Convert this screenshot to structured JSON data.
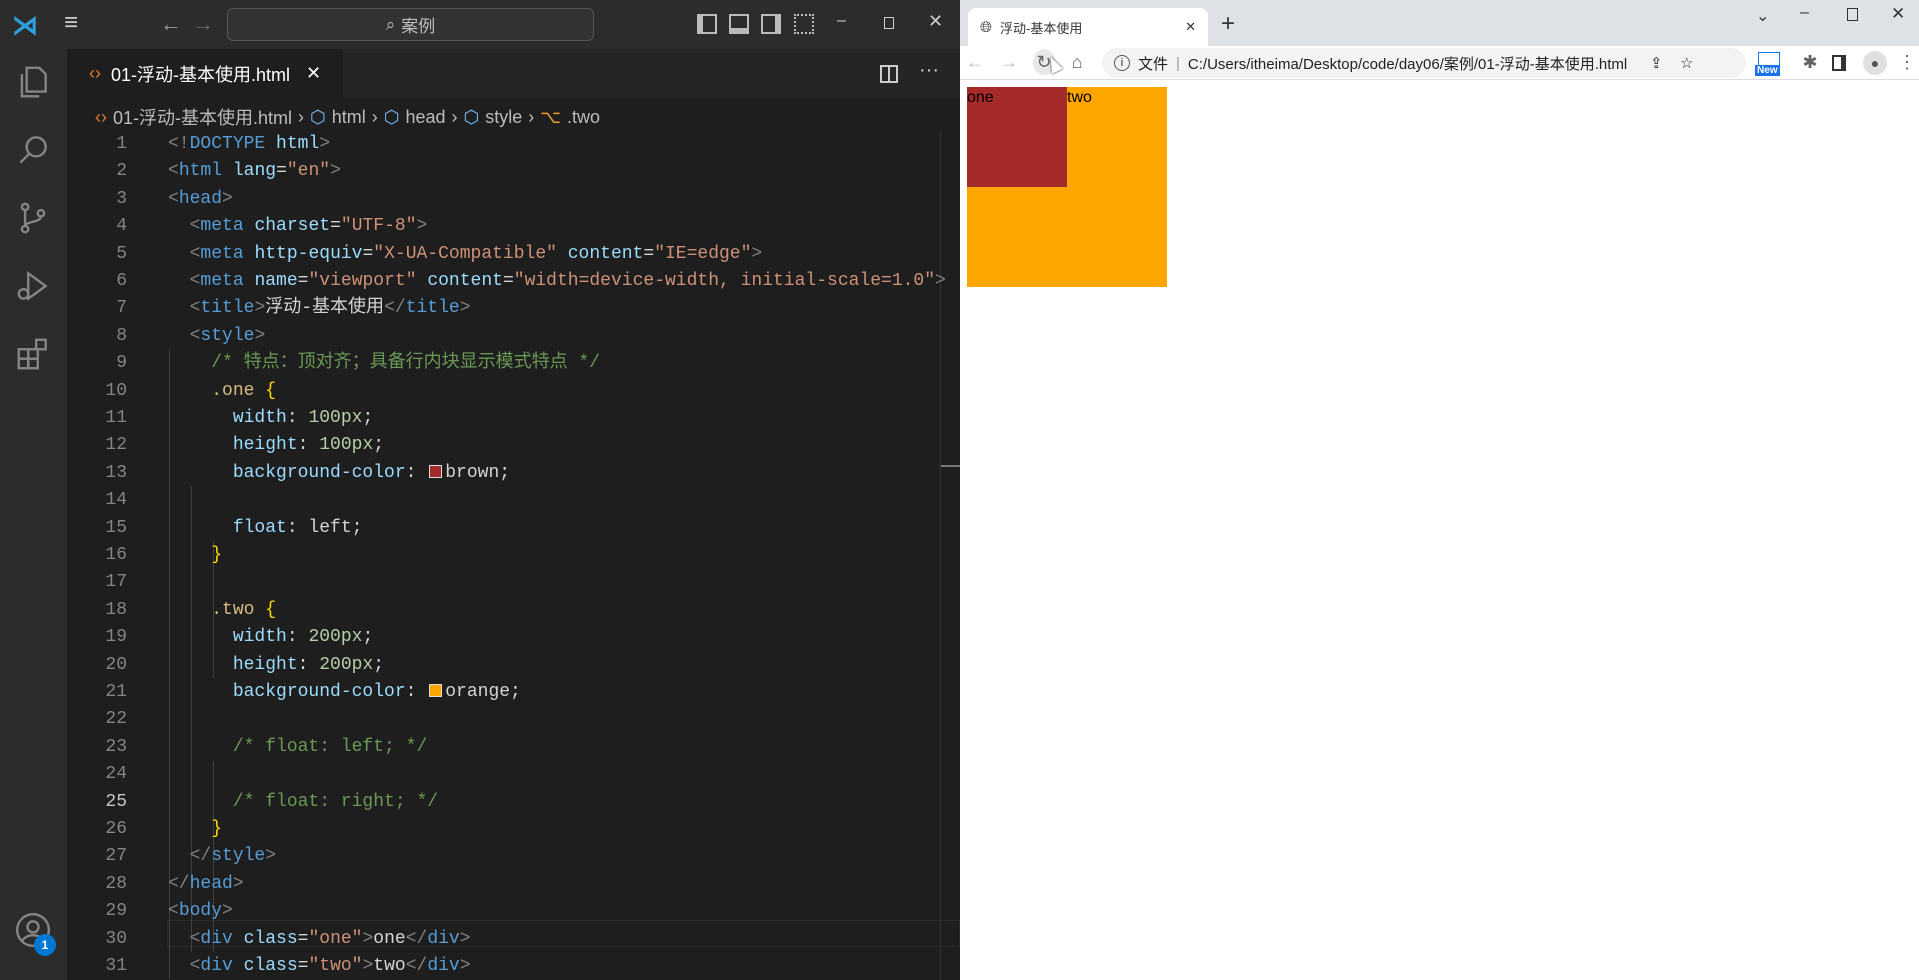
{
  "vscode": {
    "search_text": "案例",
    "tab_label": "01-浮动-基本使用.html",
    "breadcrumb": [
      "01-浮动-基本使用.html",
      "html",
      "head",
      "style",
      ".two"
    ],
    "account_badge": "1",
    "current_line": 25,
    "code": [
      [
        [
          "p",
          "<!"
        ],
        [
          "t",
          "DOCTYPE"
        ],
        [
          "w",
          " "
        ],
        [
          "a",
          "html"
        ],
        [
          "p",
          ">"
        ]
      ],
      [
        [
          "p",
          "<"
        ],
        [
          "t",
          "html"
        ],
        [
          "w",
          " "
        ],
        [
          "a",
          "lang"
        ],
        [
          "w",
          "="
        ],
        [
          "s",
          "\"en\""
        ],
        [
          "p",
          ">"
        ]
      ],
      [
        [
          "p",
          "<"
        ],
        [
          "t",
          "head"
        ],
        [
          "p",
          ">"
        ]
      ],
      [
        [
          "w",
          "  "
        ],
        [
          "p",
          "<"
        ],
        [
          "t",
          "meta"
        ],
        [
          "w",
          " "
        ],
        [
          "a",
          "charset"
        ],
        [
          "w",
          "="
        ],
        [
          "s",
          "\"UTF-8\""
        ],
        [
          "p",
          ">"
        ]
      ],
      [
        [
          "w",
          "  "
        ],
        [
          "p",
          "<"
        ],
        [
          "t",
          "meta"
        ],
        [
          "w",
          " "
        ],
        [
          "a",
          "http-equiv"
        ],
        [
          "w",
          "="
        ],
        [
          "s",
          "\"X-UA-Compatible\""
        ],
        [
          "w",
          " "
        ],
        [
          "a",
          "content"
        ],
        [
          "w",
          "="
        ],
        [
          "s",
          "\"IE=edge\""
        ],
        [
          "p",
          ">"
        ]
      ],
      [
        [
          "w",
          "  "
        ],
        [
          "p",
          "<"
        ],
        [
          "t",
          "meta"
        ],
        [
          "w",
          " "
        ],
        [
          "a",
          "name"
        ],
        [
          "w",
          "="
        ],
        [
          "s",
          "\"viewport\""
        ],
        [
          "w",
          " "
        ],
        [
          "a",
          "content"
        ],
        [
          "w",
          "="
        ],
        [
          "s",
          "\"width=device-width, initial-scale=1.0\""
        ],
        [
          "p",
          ">"
        ]
      ],
      [
        [
          "w",
          "  "
        ],
        [
          "p",
          "<"
        ],
        [
          "t",
          "title"
        ],
        [
          "p",
          ">"
        ],
        [
          "w",
          "浮动-基本使用"
        ],
        [
          "p",
          "</"
        ],
        [
          "t",
          "title"
        ],
        [
          "p",
          ">"
        ]
      ],
      [
        [
          "w",
          "  "
        ],
        [
          "p",
          "<"
        ],
        [
          "t",
          "style"
        ],
        [
          "p",
          ">"
        ]
      ],
      [
        [
          "w",
          "    "
        ],
        [
          "c",
          "/* 特点：顶对齐；具备行内块显示模式特点 */"
        ]
      ],
      [
        [
          "w",
          "    "
        ],
        [
          "sel",
          ".one"
        ],
        [
          "w",
          " "
        ],
        [
          "b",
          "{"
        ]
      ],
      [
        [
          "w",
          "      "
        ],
        [
          "a",
          "width"
        ],
        [
          "w",
          ": "
        ],
        [
          "n",
          "100px"
        ],
        [
          "w",
          ";"
        ]
      ],
      [
        [
          "w",
          "      "
        ],
        [
          "a",
          "height"
        ],
        [
          "w",
          ": "
        ],
        [
          "n",
          "100px"
        ],
        [
          "w",
          ";"
        ]
      ],
      [
        [
          "w",
          "      "
        ],
        [
          "a",
          "background-color"
        ],
        [
          "w",
          ": "
        ],
        [
          "sw",
          "#a52a2a"
        ],
        [
          "w",
          "brown;"
        ]
      ],
      [],
      [
        [
          "w",
          "      "
        ],
        [
          "a",
          "float"
        ],
        [
          "w",
          ": left;"
        ]
      ],
      [
        [
          "w",
          "    "
        ],
        [
          "b",
          "}"
        ]
      ],
      [],
      [
        [
          "w",
          "    "
        ],
        [
          "sel",
          ".two"
        ],
        [
          "w",
          " "
        ],
        [
          "b",
          "{"
        ]
      ],
      [
        [
          "w",
          "      "
        ],
        [
          "a",
          "width"
        ],
        [
          "w",
          ": "
        ],
        [
          "n",
          "200px"
        ],
        [
          "w",
          ";"
        ]
      ],
      [
        [
          "w",
          "      "
        ],
        [
          "a",
          "height"
        ],
        [
          "w",
          ": "
        ],
        [
          "n",
          "200px"
        ],
        [
          "w",
          ";"
        ]
      ],
      [
        [
          "w",
          "      "
        ],
        [
          "a",
          "background-color"
        ],
        [
          "w",
          ": "
        ],
        [
          "sw",
          "#ffa500"
        ],
        [
          "w",
          "orange;"
        ]
      ],
      [],
      [
        [
          "w",
          "      "
        ],
        [
          "c",
          "/* float: left; */"
        ]
      ],
      [],
      [
        [
          "w",
          "      "
        ],
        [
          "c",
          "/* float: right; */"
        ]
      ],
      [
        [
          "w",
          "    "
        ],
        [
          "b",
          "}"
        ]
      ],
      [
        [
          "w",
          "  "
        ],
        [
          "p",
          "</"
        ],
        [
          "t",
          "style"
        ],
        [
          "p",
          ">"
        ]
      ],
      [
        [
          "p",
          "</"
        ],
        [
          "t",
          "head"
        ],
        [
          "p",
          ">"
        ]
      ],
      [
        [
          "p",
          "<"
        ],
        [
          "t",
          "body"
        ],
        [
          "p",
          ">"
        ]
      ],
      [
        [
          "w",
          "  "
        ],
        [
          "p",
          "<"
        ],
        [
          "t",
          "div"
        ],
        [
          "w",
          " "
        ],
        [
          "a",
          "class"
        ],
        [
          "w",
          "="
        ],
        [
          "s",
          "\"one\""
        ],
        [
          "p",
          ">"
        ],
        [
          "w",
          "one"
        ],
        [
          "p",
          "</"
        ],
        [
          "t",
          "div"
        ],
        [
          "p",
          ">"
        ]
      ],
      [
        [
          "w",
          "  "
        ],
        [
          "p",
          "<"
        ],
        [
          "t",
          "div"
        ],
        [
          "w",
          " "
        ],
        [
          "a",
          "class"
        ],
        [
          "w",
          "="
        ],
        [
          "s",
          "\"two\""
        ],
        [
          "p",
          ">"
        ],
        [
          "w",
          "two"
        ],
        [
          "p",
          "</"
        ],
        [
          "t",
          "div"
        ],
        [
          "p",
          ">"
        ]
      ]
    ]
  },
  "browser": {
    "tab_title": "浮动-基本使用",
    "file_label": "文件",
    "url": "C:/Users/itheima/Desktop/code/day06/案例/01-浮动-基本使用.html",
    "new_badge": "New",
    "page": {
      "one_text": "one",
      "two_text": "two",
      "one_color": "#a52a2a",
      "two_color": "#ffa500"
    }
  }
}
